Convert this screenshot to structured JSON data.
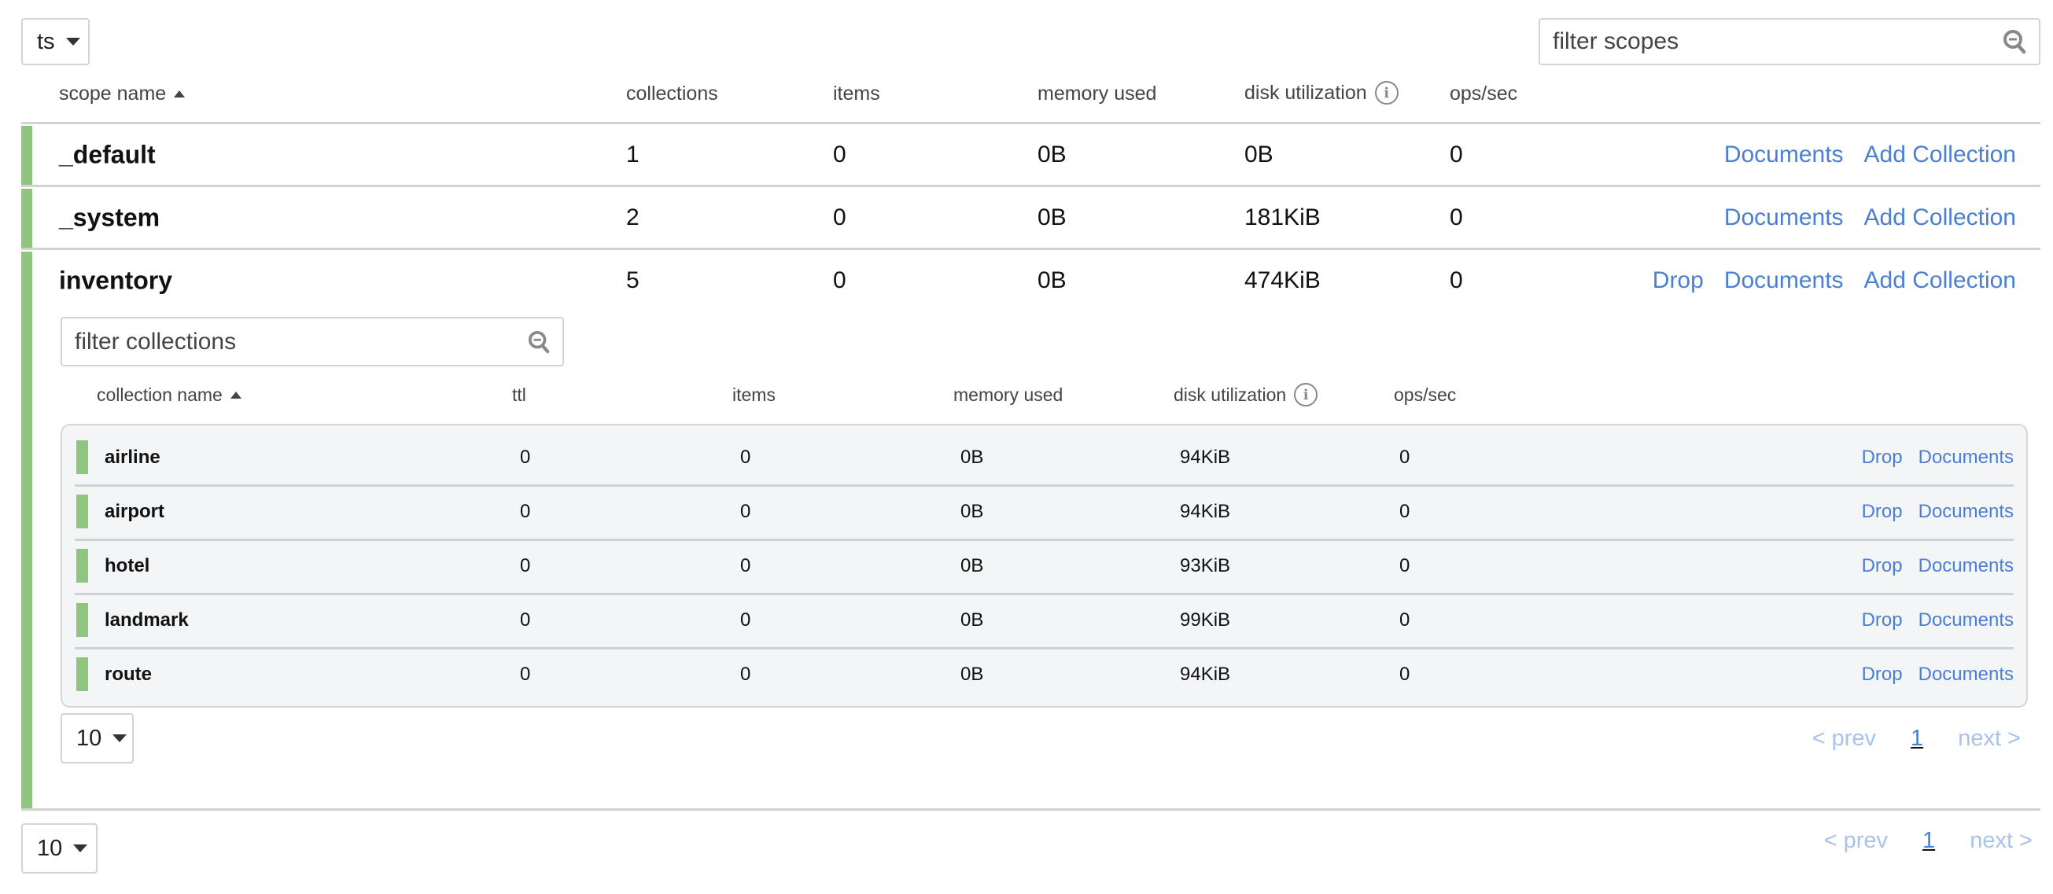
{
  "bucket_select": {
    "value": "ts"
  },
  "scope_filter": {
    "placeholder": "filter scopes"
  },
  "scope_headers": {
    "name": "scope name",
    "collections": "collections",
    "items": "items",
    "memory": "memory used",
    "disk": "disk utilization",
    "ops": "ops/sec"
  },
  "scopes": [
    {
      "name": "_default",
      "collections": "1",
      "items": "0",
      "memory": "0B",
      "disk": "0B",
      "ops": "0",
      "actions": [
        "Documents",
        "Add Collection"
      ]
    },
    {
      "name": "_system",
      "collections": "2",
      "items": "0",
      "memory": "0B",
      "disk": "181KiB",
      "ops": "0",
      "actions": [
        "Documents",
        "Add Collection"
      ]
    },
    {
      "name": "inventory",
      "collections": "5",
      "items": "0",
      "memory": "0B",
      "disk": "474KiB",
      "ops": "0",
      "actions": [
        "Drop",
        "Documents",
        "Add Collection"
      ]
    }
  ],
  "collection_filter": {
    "placeholder": "filter collections"
  },
  "collection_headers": {
    "name": "collection name",
    "ttl": "ttl",
    "items": "items",
    "memory": "memory used",
    "disk": "disk utilization",
    "ops": "ops/sec"
  },
  "collections": [
    {
      "name": "airline",
      "ttl": "0",
      "items": "0",
      "memory": "0B",
      "disk": "94KiB",
      "ops": "0"
    },
    {
      "name": "airport",
      "ttl": "0",
      "items": "0",
      "memory": "0B",
      "disk": "94KiB",
      "ops": "0"
    },
    {
      "name": "hotel",
      "ttl": "0",
      "items": "0",
      "memory": "0B",
      "disk": "93KiB",
      "ops": "0"
    },
    {
      "name": "landmark",
      "ttl": "0",
      "items": "0",
      "memory": "0B",
      "disk": "99KiB",
      "ops": "0"
    },
    {
      "name": "route",
      "ttl": "0",
      "items": "0",
      "memory": "0B",
      "disk": "94KiB",
      "ops": "0"
    }
  ],
  "collection_actions": [
    "Drop",
    "Documents"
  ],
  "collection_pagination": {
    "page_size": "10",
    "prev": "< prev",
    "page": "1",
    "next": "next >"
  },
  "scope_pagination": {
    "page_size": "10",
    "prev": "< prev",
    "page": "1",
    "next": "next >"
  },
  "colors": {
    "status_green": "#8fc57f",
    "link_blue": "#4a7fd4",
    "link_disabled": "#a8c3ea"
  }
}
